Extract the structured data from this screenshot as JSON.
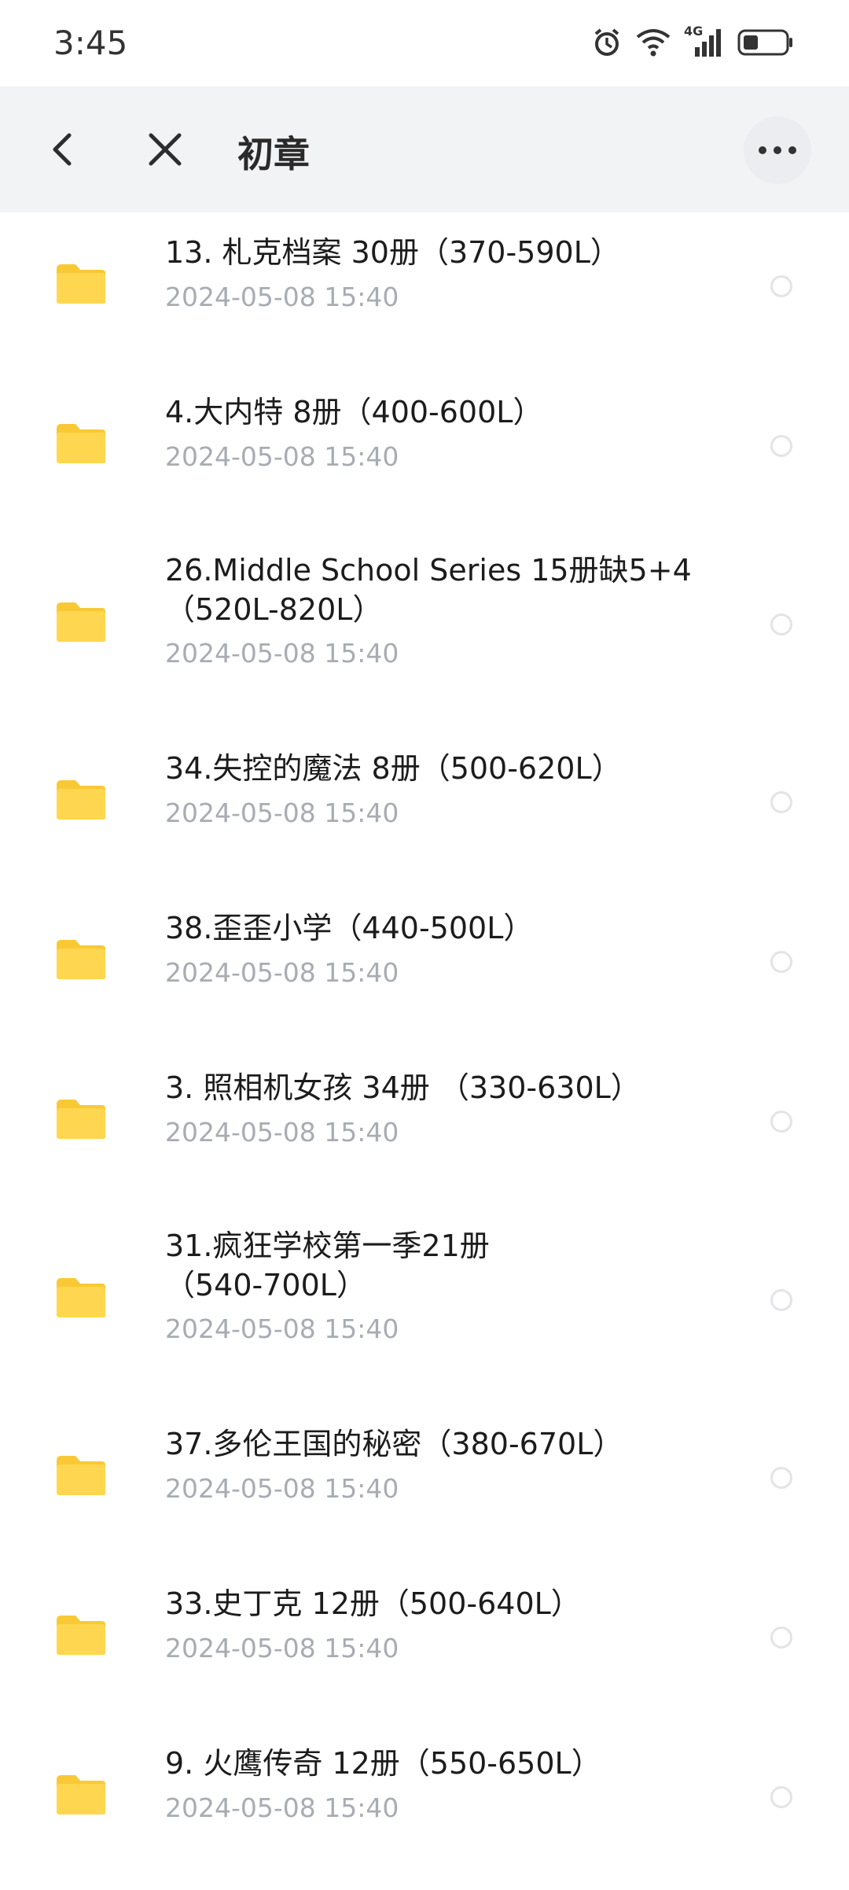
{
  "status_bar": {
    "time": "3:45",
    "network": "4G"
  },
  "toolbar": {
    "title": "初章"
  },
  "colors": {
    "folder": "#FFD64F",
    "folder_tab": "#F9C935",
    "date": "#A8ACB3",
    "toolbar_bg": "#F2F3F5"
  },
  "items": [
    {
      "name": "13. 札克档案 30册（370-590L）",
      "date": "2024-05-08  15:40"
    },
    {
      "name": "4.大内特 8册（400-600L）",
      "date": "2024-05-08  15:40"
    },
    {
      "name": "26.Middle School Series 15册缺5+4（520L-820L）",
      "date": "2024-05-08  15:40"
    },
    {
      "name": "34.失控的魔法 8册（500-620L）",
      "date": "2024-05-08  15:40"
    },
    {
      "name": "38.歪歪小学（440-500L）",
      "date": "2024-05-08  15:40"
    },
    {
      "name": "3. 照相机女孩 34册 （330-630L）",
      "date": "2024-05-08  15:40"
    },
    {
      "name": "31.疯狂学校第一季21册（540-700L）",
      "date": "2024-05-08  15:40"
    },
    {
      "name": "37.多伦王国的秘密（380-670L）",
      "date": "2024-05-08  15:40"
    },
    {
      "name": "33.史丁克 12册（500-640L）",
      "date": "2024-05-08  15:40"
    },
    {
      "name": "9. 火鹰传奇 12册（550-650L）",
      "date": "2024-05-08  15:40"
    }
  ]
}
